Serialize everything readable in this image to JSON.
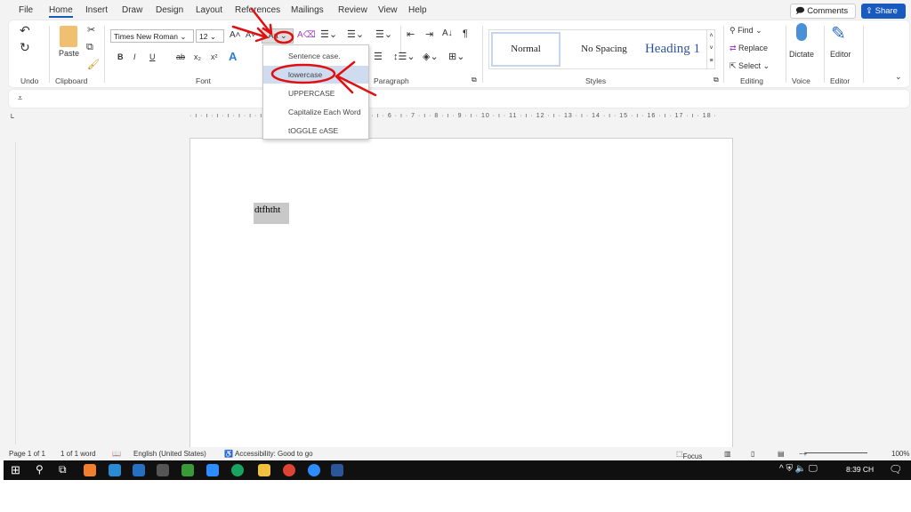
{
  "menu": [
    "File",
    "Home",
    "Insert",
    "Draw",
    "Design",
    "Layout",
    "References",
    "Mailings",
    "Review",
    "View",
    "Help"
  ],
  "top_buttons": {
    "comments": "Comments",
    "share": "Share"
  },
  "ribbon": {
    "undo_group": "Undo",
    "clipboard_group": "Clipboard",
    "paste": "Paste",
    "font_name": "Times New Roman",
    "font_size": "12",
    "font_group": "Font",
    "bold": "B",
    "italic": "I",
    "underline": "U",
    "strike": "ab",
    "subscript": "x₂",
    "superscript": "x²",
    "case_button": "Aa",
    "paragraph_group": "Paragraph",
    "pilcrow": "¶",
    "styles": [
      "Normal",
      "No Spacing",
      "Heading 1"
    ],
    "styles_group": "Styles",
    "find": "Find",
    "replace": "Replace",
    "select": "Select",
    "editing_group": "Editing",
    "dictate": "Dictate",
    "voice_group": "Voice",
    "editor": "Editor",
    "editor_group": "Editor"
  },
  "change_case_menu": [
    "Sentence case.",
    "lowercase",
    "UPPERCASE",
    "Capitalize Each Word",
    "tOGGLE cASE"
  ],
  "ruler_text": "· ı · ı · ı · ı · ı · ı · ı · 1 · ı · 2 · ı · 3 · ı · 4 · ı · 5 · ı · 6 · ı · 7 · ı · 8 · ı · 9 · ı · 10 · ı · 11 · ı · 12 · ı · 13 · ı · 14 · ı · 15 · ı · 16 · ı · 17 · ı · 18 ·",
  "document": {
    "text": "dtfhtht"
  },
  "status": {
    "page": "Page 1 of 1",
    "words": "1 of 1 word",
    "language": "English (United States)",
    "accessibility": "Accessibility: Good to go",
    "focus": "Focus",
    "zoom": "100%"
  },
  "taskbar": {
    "time": "8:39 CH"
  },
  "colors": {
    "accent": "#185abd",
    "annotation": "#e01010"
  }
}
